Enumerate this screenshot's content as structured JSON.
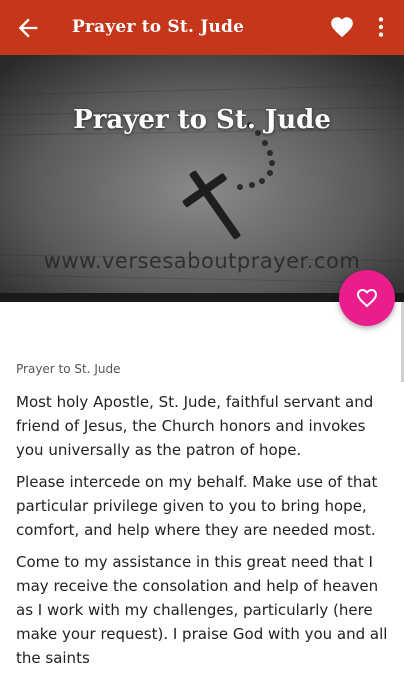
{
  "appbar": {
    "title": "Prayer to St. Jude",
    "back_icon": "arrow-back-icon",
    "favorite_icon": "heart-filled-icon",
    "more_icon": "more-vert-icon",
    "color": "#c5361b"
  },
  "hero": {
    "title": "Prayer to St. Jude",
    "watermark": "www.versesaboutprayer.com"
  },
  "fab": {
    "icon": "heart-outline-icon",
    "color": "#e91e8c"
  },
  "content": {
    "subtitle": "Prayer to St. Jude",
    "paragraphs": [
      "Most holy Apostle, St. Jude, faithful servant and friend of Jesus, the Church honors and invokes you universally as the patron of hope.",
      "Please intercede on my behalf. Make use of that particular privilege given to you to bring hope, comfort, and help where they are needed most.",
      "Come to my assistance in this great need that I may receive the consolation and help of heaven as I work with my challenges, particularly (here make your request). I praise God with you and all the saints"
    ]
  }
}
